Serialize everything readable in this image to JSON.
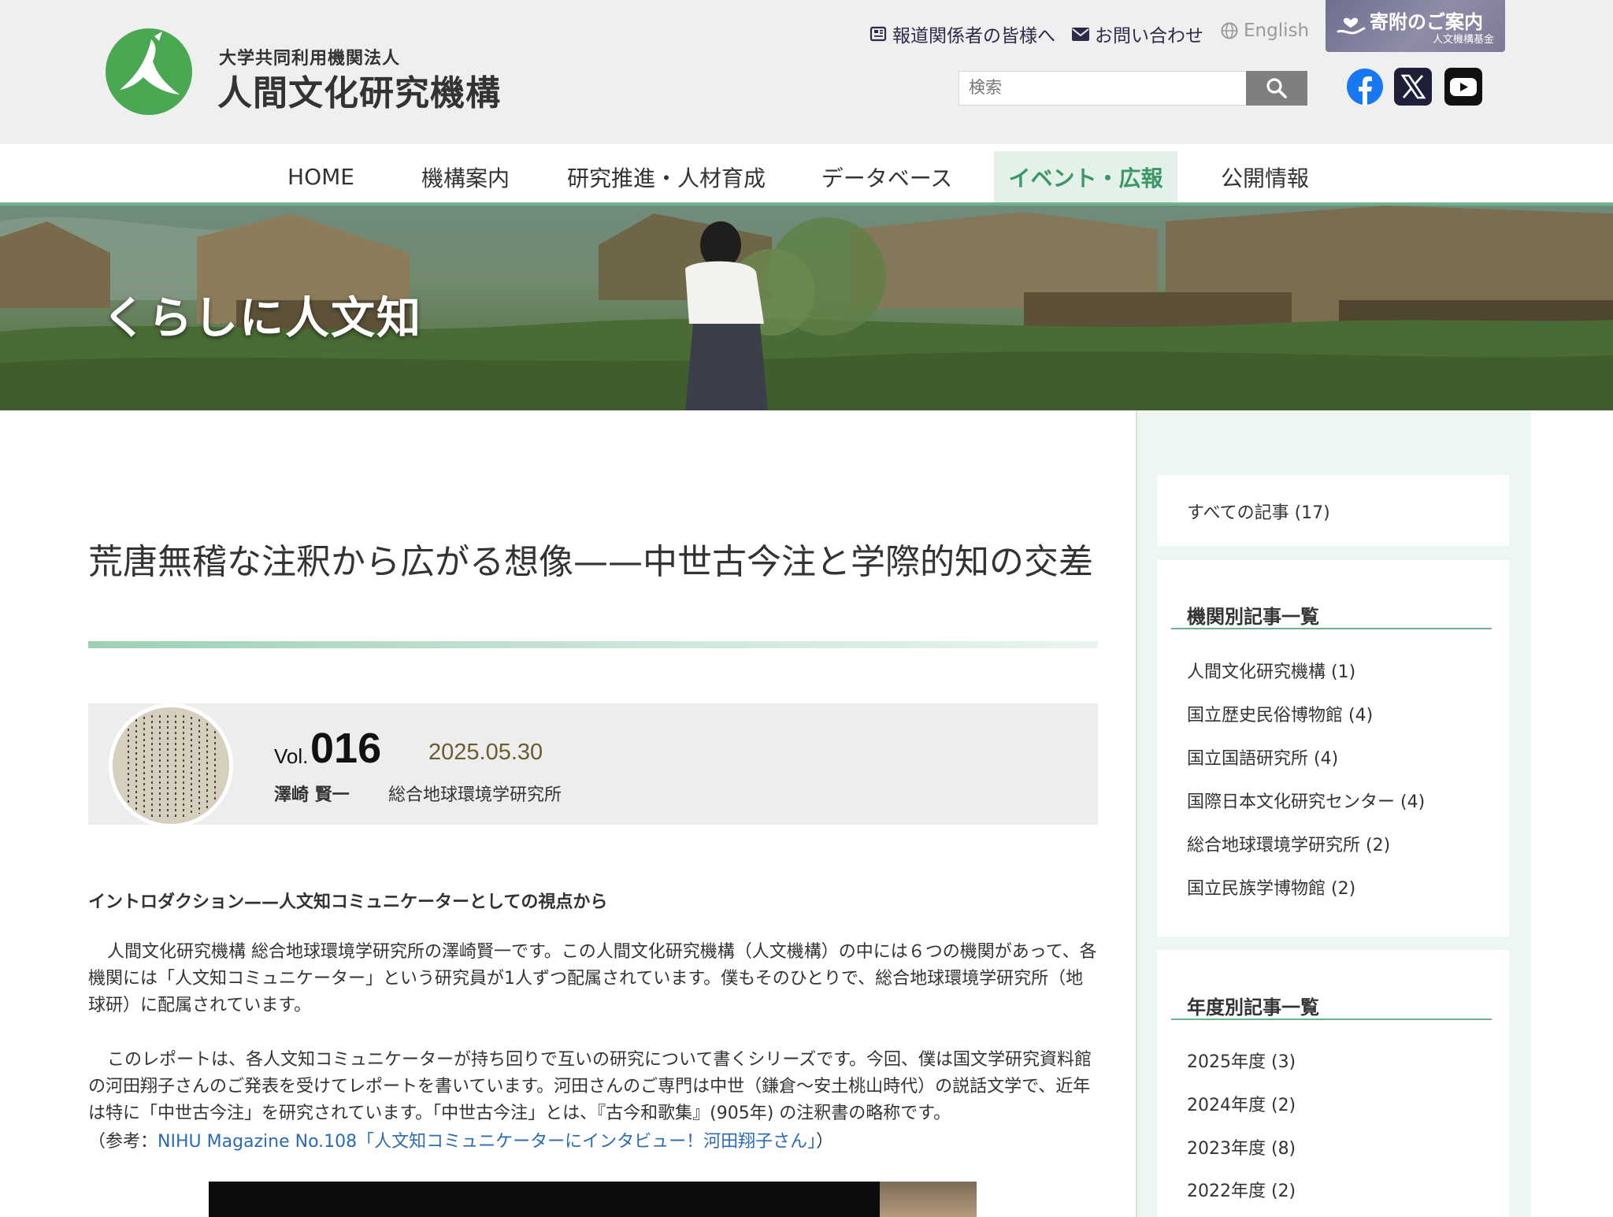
{
  "header": {
    "org_type": "大学共同利用機関法人",
    "org_name": "人間文化研究機構",
    "links": {
      "press": "報道関係者の皆様へ",
      "contact": "お問い合わせ",
      "english": "English"
    },
    "donation": {
      "title": "寄附のご案内",
      "subtitle": "人文機構基金"
    },
    "search": {
      "placeholder": "検索"
    },
    "social": {
      "facebook_color": "#1877f2",
      "x_color": "#1f1f3a",
      "youtube_color": "#111111"
    }
  },
  "nav": {
    "items": [
      {
        "label": "HOME"
      },
      {
        "label": "機構案内"
      },
      {
        "label": "研究推進・人材育成"
      },
      {
        "label": "データベース"
      },
      {
        "label": "イベント・広報"
      },
      {
        "label": "公開情報"
      }
    ],
    "active_color": "#3b9668"
  },
  "hero": {
    "title": "くらしに人文知"
  },
  "article": {
    "title": "荒唐無稽な注釈から広がる想像——中世古今注と学際的知の交差",
    "vol_prefix": "Vol.",
    "vol_number": "016",
    "date": "2025.05.30",
    "author": "澤崎 賢一",
    "affiliation": "総合地球環境学研究所",
    "intro_heading": "イントロダクション——人文知コミュニケーターとしての視点から",
    "paragraphs": [
      "人間文化研究機構 総合地球環境学研究所の澤崎賢一です。この人間文化研究機構（人文機構）の中には６つの機関があって、各機関には「人文知コミュニケーター」という研究員が1人ずつ配属されています。僕もそのひとりで、総合地球環境学研究所（地球研）に配属されています。",
      "このレポートは、各人文知コミュニケーターが持ち回りで互いの研究について書くシリーズです。今回、僕は国文学研究資料館の河田翔子さんのご発表を受けてレポートを書いています。河田さんのご専門は中世（鎌倉〜安土桃山時代）の説話文学で、近年は特に「中世古今注」を研究されています。「中世古今注」とは、『古今和歌集』(905年) の注釈書の略称です。"
    ],
    "ref_prefix": "（参考：",
    "ref_link": "NIHU Magazine No.108「人文知コミュニケーターにインタビュー！河田翔子さん」",
    "ref_suffix": "）",
    "link_color": "#2a6bb5"
  },
  "sidebar": {
    "all_articles": "すべての記事 (17)",
    "by_institution_heading": "機関別記事一覧",
    "institutions": [
      {
        "label": "人間文化研究機構 (1)"
      },
      {
        "label": "国立歴史民俗博物館 (4)"
      },
      {
        "label": "国立国語研究所 (4)"
      },
      {
        "label": "国際日本文化研究センター (4)"
      },
      {
        "label": "総合地球環境学研究所 (2)"
      },
      {
        "label": "国立民族学博物館 (2)"
      }
    ],
    "by_year_heading": "年度別記事一覧",
    "years": [
      {
        "label": "2025年度 (3)"
      },
      {
        "label": "2024年度 (2)"
      },
      {
        "label": "2023年度 (8)"
      },
      {
        "label": "2022年度 (2)"
      }
    ]
  }
}
